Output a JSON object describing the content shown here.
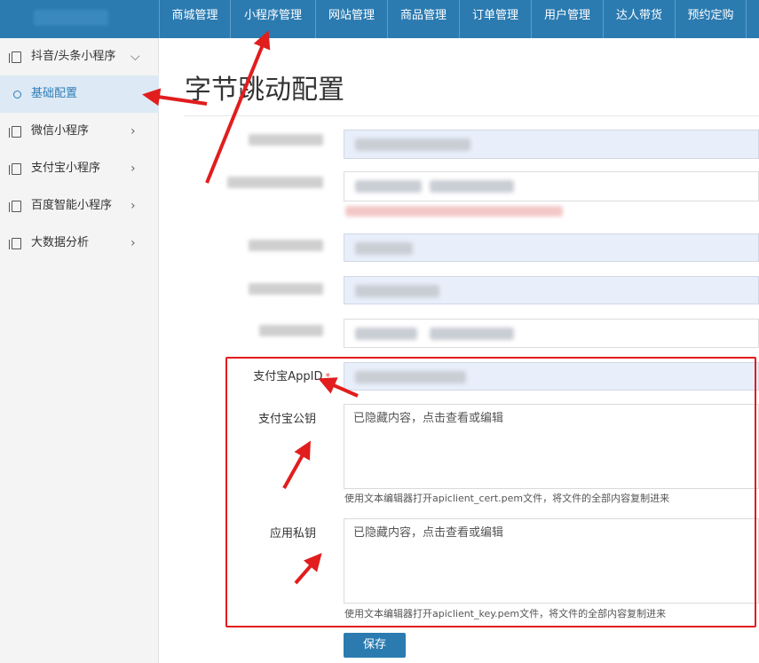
{
  "nav": {
    "items": [
      "商城管理",
      "小程序管理",
      "网站管理",
      "商品管理",
      "订单管理",
      "用户管理",
      "达人带货",
      "预约定购"
    ]
  },
  "sidebar": {
    "items": [
      {
        "label": "抖音/头条小程序",
        "chevron": "⌵"
      },
      {
        "label": "基础配置"
      },
      {
        "label": "微信小程序",
        "chevron": "›"
      },
      {
        "label": "支付宝小程序",
        "chevron": "›"
      },
      {
        "label": "百度智能小程序",
        "chevron": "›"
      },
      {
        "label": "大数据分析",
        "chevron": "›"
      }
    ]
  },
  "page": {
    "title": "字节跳动配置"
  },
  "form": {
    "alipay_appid_label": "支付宝AppID",
    "required_mark": "*",
    "alipay_public_key_label": "支付宝公钥",
    "alipay_public_key_value": "已隐藏内容，点击查看或编辑",
    "alipay_public_key_help": "使用文本编辑器打开apiclient_cert.pem文件，将文件的全部内容复制进来",
    "private_key_label": "应用私钥",
    "private_key_value": "已隐藏内容，点击查看或编辑",
    "private_key_help": "使用文本编辑器打开apiclient_key.pem文件，将文件的全部内容复制进来",
    "save_label": "保存"
  },
  "colors": {
    "header_bg": "#2b7bb1",
    "active_bg": "#dde9f4",
    "annotation_red": "#e11d1d"
  }
}
